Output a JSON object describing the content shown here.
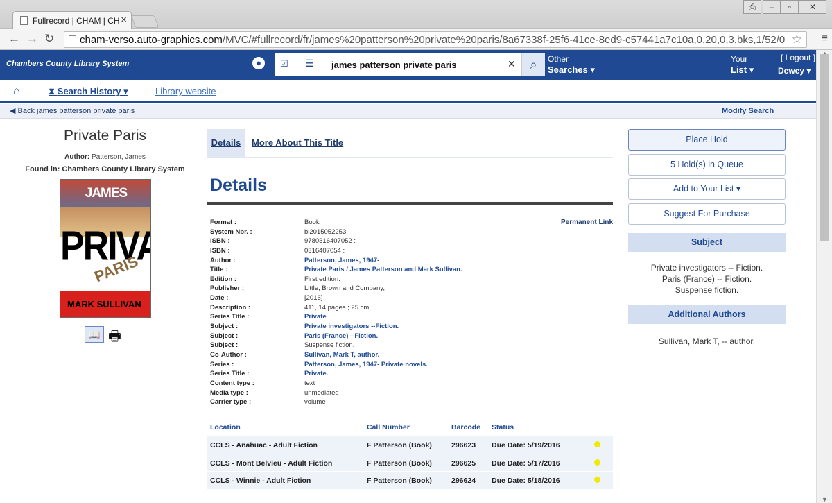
{
  "browser": {
    "tab_title": "Fullrecord | CHAM | CHAM",
    "url_host": "cham-verso.auto-graphics.com",
    "url_path": "/MVC/#fullrecord/fr/james%20patterson%20private%20paris/8a67338f-25f6-41ce-8ed9-c57441a7c10a,0,20,0,3,bks,1/52/0"
  },
  "header": {
    "site_name": "Chambers County Library System",
    "search_query": "james patterson private paris",
    "other_label": "Other",
    "searches_label": "Searches",
    "your_label": "Your",
    "list_label": "List",
    "logout_label": "[ Logout ]",
    "user_name": "Dewey"
  },
  "subnav": {
    "search_history": "Search History",
    "library_website": "Library website"
  },
  "backbar": {
    "back_label": "Back james patterson private paris",
    "modify_search": "Modify Search"
  },
  "book": {
    "title": "Private Paris",
    "author_label": "Author:",
    "author": "Patterson, James",
    "found_in": "Found in: Chambers County Library System",
    "cover_author": "JAMES PATTERSON",
    "cover_title": "PRIVATE",
    "cover_subtitle": "PARIS",
    "cover_coauthor": "MARK SULLIVAN"
  },
  "tabs": {
    "details": "Details",
    "more": "More About This Title"
  },
  "details": {
    "heading": "Details",
    "permanent_link": "Permanent Link",
    "fields": [
      {
        "label": "Format :",
        "value": "Book",
        "link": false
      },
      {
        "label": "System Nbr. :",
        "value": "bl2015052253",
        "link": false
      },
      {
        "label": "ISBN :",
        "value": "9780316407052 :",
        "link": false
      },
      {
        "label": "ISBN :",
        "value": "0316407054 :",
        "link": false
      },
      {
        "label": "Author :",
        "value": "Patterson, James, 1947-",
        "link": true
      },
      {
        "label": "Title :",
        "value": "Private Paris / James Patterson and Mark Sullivan.",
        "link": true
      },
      {
        "label": "Edition :",
        "value": "First edition.",
        "link": false
      },
      {
        "label": "Publisher :",
        "value": "Little, Brown and Company,",
        "link": false
      },
      {
        "label": "Date :",
        "value": "[2016]",
        "link": false
      },
      {
        "label": "Description :",
        "value": "411, 14 pages ; 25 cm.",
        "link": false
      },
      {
        "label": "Series Title :",
        "value": "Private",
        "link": true
      },
      {
        "label": "Subject :",
        "value": "Private investigators --Fiction.",
        "link": true
      },
      {
        "label": "Subject :",
        "value": "Paris (France) --Fiction.",
        "link": true
      },
      {
        "label": "Subject :",
        "value": "Suspense fiction.",
        "link": false
      },
      {
        "label": "Co-Author :",
        "value": "Sullivan, Mark T, author.",
        "link": true
      },
      {
        "label": "Series :",
        "value": "Patterson, James, 1947- Private novels.",
        "link": true
      },
      {
        "label": "Series Title :",
        "value": "Private.",
        "link": true
      },
      {
        "label": "Content type :",
        "value": "text",
        "link": false
      },
      {
        "label": "Media type :",
        "value": "unmediated",
        "link": false
      },
      {
        "label": "Carrier type :",
        "value": "volume",
        "link": false
      }
    ]
  },
  "holdings": {
    "headers": {
      "location": "Location",
      "call_number": "Call Number",
      "barcode": "Barcode",
      "status": "Status"
    },
    "rows": [
      {
        "location": "CCLS - Anahuac - Adult Fiction",
        "call_number": "F Patterson (Book)",
        "barcode": "296623",
        "status": "Due Date: 5/19/2016"
      },
      {
        "location": "CCLS - Mont Belvieu - Adult Fiction",
        "call_number": "F Patterson (Book)",
        "barcode": "296625",
        "status": "Due Date: 5/17/2016"
      },
      {
        "location": "CCLS - Winnie - Adult Fiction",
        "call_number": "F Patterson (Book)",
        "barcode": "296624",
        "status": "Due Date: 5/18/2016"
      }
    ]
  },
  "sidebar": {
    "place_hold": "Place Hold",
    "holds_in_queue": "5 Hold(s) in Queue",
    "add_to_list": "Add to Your List",
    "suggest_purchase": "Suggest For Purchase",
    "subject_heading": "Subject",
    "subjects": [
      "Private investigators -- Fiction.",
      "Paris (France) -- Fiction.",
      "Suspense fiction."
    ],
    "additional_authors_heading": "Additional Authors",
    "additional_authors": [
      "Sullivan, Mark T, -- author."
    ]
  },
  "colors": {
    "brand": "#1f4a93",
    "available_dot": "#f0ea00"
  }
}
